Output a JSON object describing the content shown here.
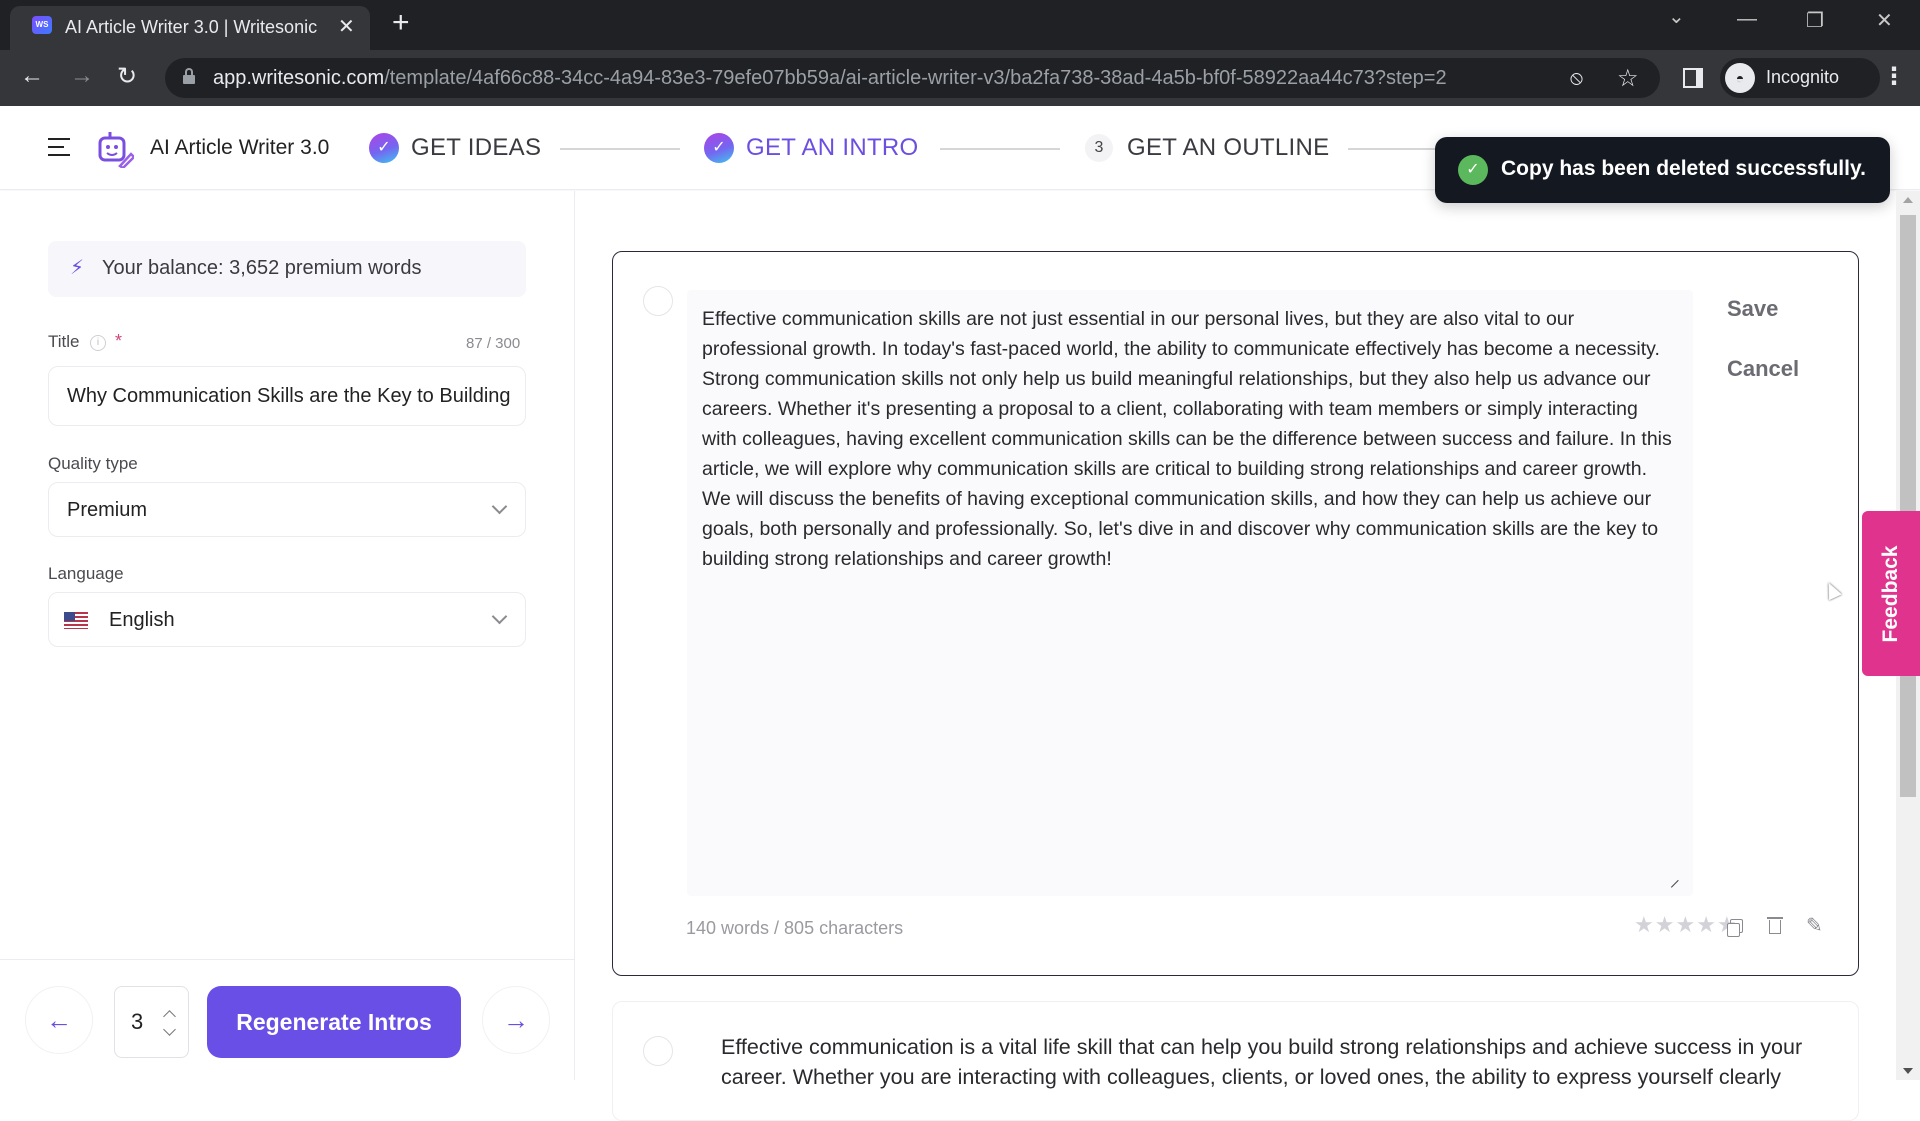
{
  "browser": {
    "tab_title": "AI Article Writer 3.0 | Writesonic",
    "favicon_label": "WS",
    "url_host": "app.writesonic.com",
    "url_path": "/template/4af66c88-34cc-4a94-83e3-79efe07bb59a/ai-article-writer-v3/ba2fa738-38ad-4a5b-bf0f-58922aa44c73?step=2",
    "profile_label": "Incognito",
    "icons": {
      "back": "←",
      "forward": "→",
      "reload": "↻",
      "close_tab": "✕",
      "new_tab": "+",
      "tab_search": "⌄",
      "minimize": "—",
      "restore": "❐",
      "close_window": "✕",
      "eye_off": "⦸",
      "star": "☆",
      "menu": "⋮",
      "incognito": "◓"
    }
  },
  "header": {
    "app_name": "AI Article Writer 3.0",
    "steps": [
      {
        "label": "GET IDEAS",
        "state": "done",
        "marker": "✓"
      },
      {
        "label": "GET AN INTRO",
        "state": "active",
        "marker": "✓"
      },
      {
        "label": "GET AN OUTLINE",
        "state": "pending",
        "marker": "3"
      }
    ]
  },
  "toast": {
    "icon": "✓",
    "message": "Copy has been deleted successfully."
  },
  "sidebar": {
    "balance_icon": "⚡",
    "balance_text": "Your balance: 3,652 premium words",
    "title_label": "Title",
    "title_info_icon": "i",
    "title_required": "*",
    "title_count": "87 / 300",
    "title_value": "Why Communication Skills are the Key to Building Strong Relationships and Career Growth",
    "quality_label": "Quality type",
    "quality_value": "Premium",
    "language_label": "Language",
    "language_value": "English",
    "count_value": "3",
    "prev_icon": "←",
    "next_icon": "→",
    "regenerate_label": "Regenerate Intros"
  },
  "main": {
    "cards": [
      {
        "text": "Effective communication skills are not just essential in our personal lives, but they are also vital to our professional growth. In today's fast-paced world, the ability to communicate effectively has become a necessity. Strong communication skills not only help us build meaningful relationships, but they also help us advance our careers. Whether it's presenting a proposal to a client, collaborating with team members or simply interacting with colleagues, having excellent communication skills can be the difference between success and failure. In this article, we will explore why communication skills are critical to building strong relationships and career growth. We will discuss the benefits of having exceptional communication skills, and how they can help us achieve our goals, both personally and professionally. So, let's dive in and discover why communication skills are the key to building strong relationships and career growth!",
        "save_label": "Save",
        "cancel_label": "Cancel",
        "stats": "140 words / 805 characters",
        "rating": 0,
        "rating_max": 5,
        "star_glyph": "★",
        "edit_icon": "✎"
      },
      {
        "text": "Effective communication is a vital life skill that can help you build strong relationships and achieve success in your career. Whether you are interacting with colleagues, clients, or loved ones, the ability to express yourself clearly"
      }
    ]
  },
  "feedback_label": "Feedback"
}
